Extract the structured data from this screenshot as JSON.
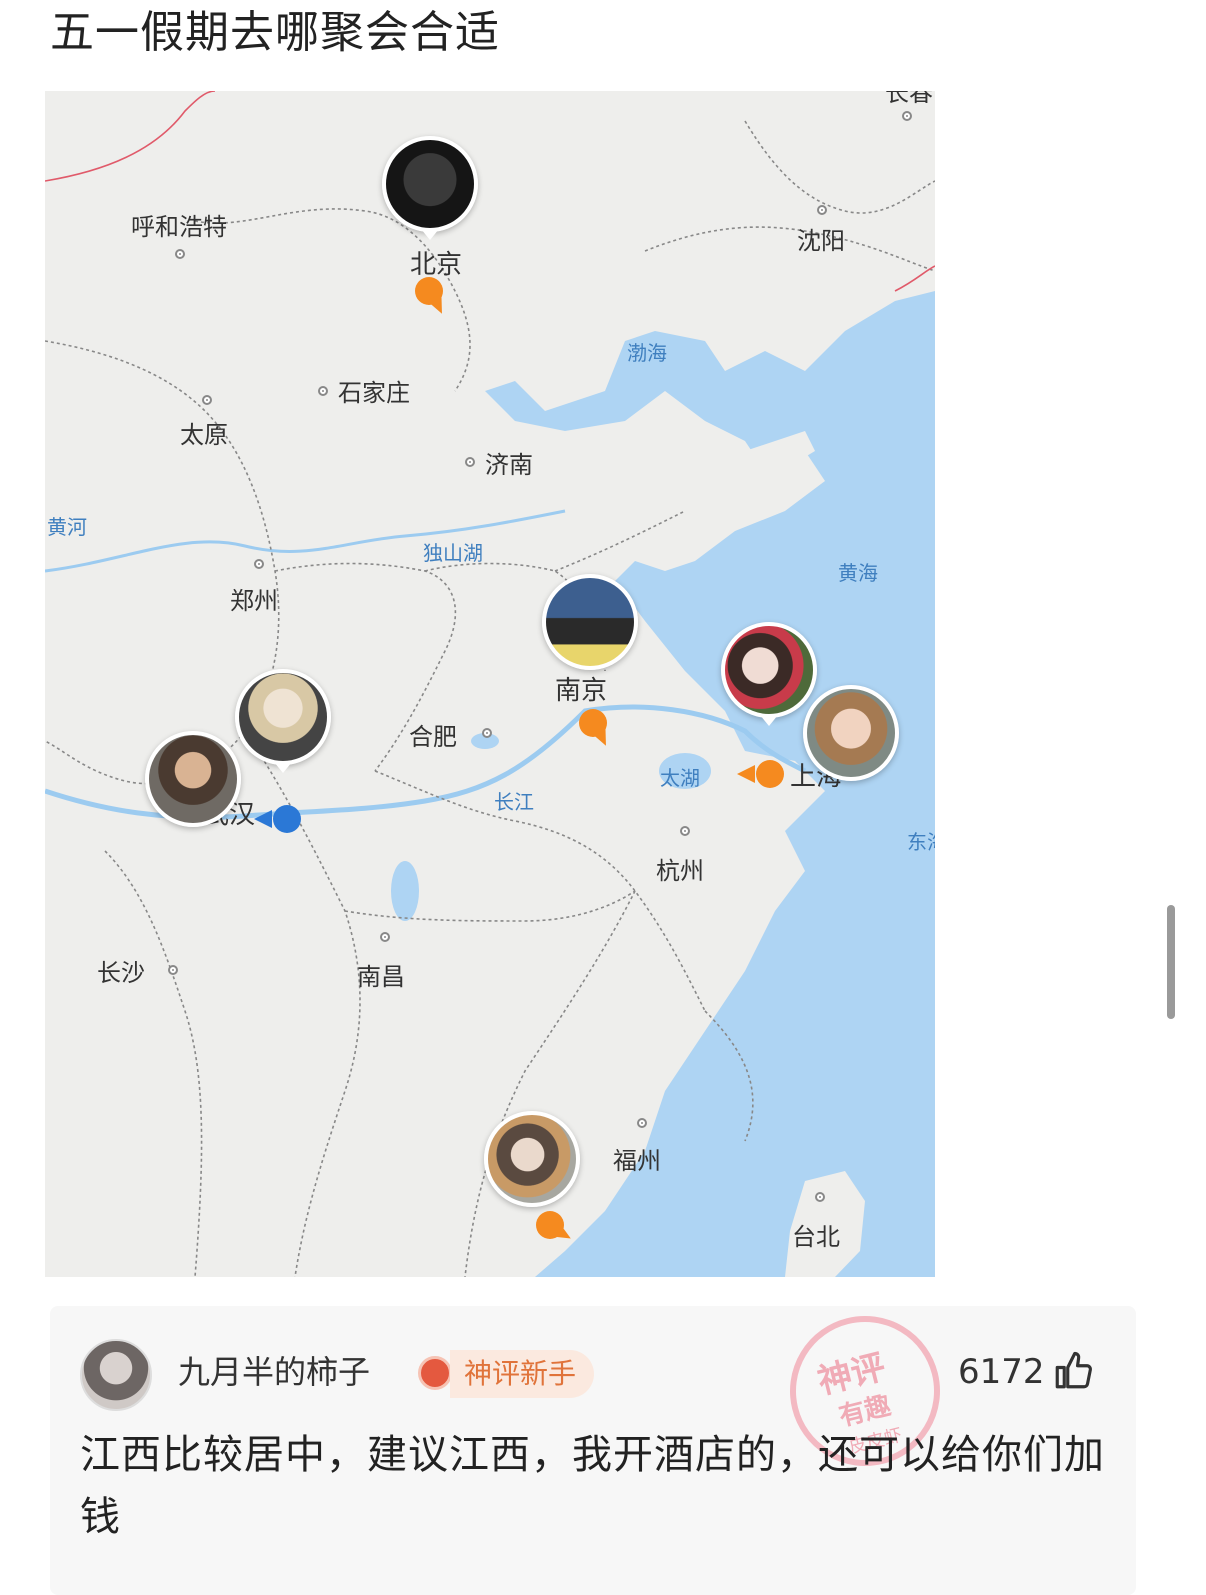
{
  "post": {
    "title": "五一假期去哪聚会合适"
  },
  "map": {
    "colors": {
      "land": "#eeeeec",
      "sea": "#aed4f3",
      "border": "#888888",
      "marker_orange": "#f58a1f",
      "marker_blue": "#2b78d6"
    },
    "cities": {
      "beijing": "北京",
      "shenyang": "沈阳",
      "huhehaote": "呼和浩特",
      "shijiazhuang": "石家庄",
      "taiyuan": "太原",
      "jinan": "济南",
      "zhengzhou": "郑州",
      "nanjing": "南京",
      "hefei": "合肥",
      "wuhan": "武汉",
      "shanghai": "上海",
      "hangzhou": "杭州",
      "changsha": "长沙",
      "nanchang": "南昌",
      "fuzhou": "福州",
      "taibei": "台北",
      "changchun": "长春"
    },
    "water": {
      "bohai": "渤海",
      "huanghai": "黄海",
      "donghai": "东海",
      "huanghe": "黄河",
      "dushanhu": "独山湖",
      "changjiang": "长江",
      "taihu": "太湖"
    }
  },
  "comment": {
    "username": "九月半的柿子",
    "badge": "神评新手",
    "likes": "6172",
    "stamp": {
      "line1": "神评",
      "line2": "有趣",
      "line3": "皮皮虾"
    },
    "text": "江西比较居中，建议江西，我开酒店的，还可以给你们加钱",
    "icons": {
      "like": "thumbs-up-icon",
      "badge": "badge-icon"
    }
  }
}
